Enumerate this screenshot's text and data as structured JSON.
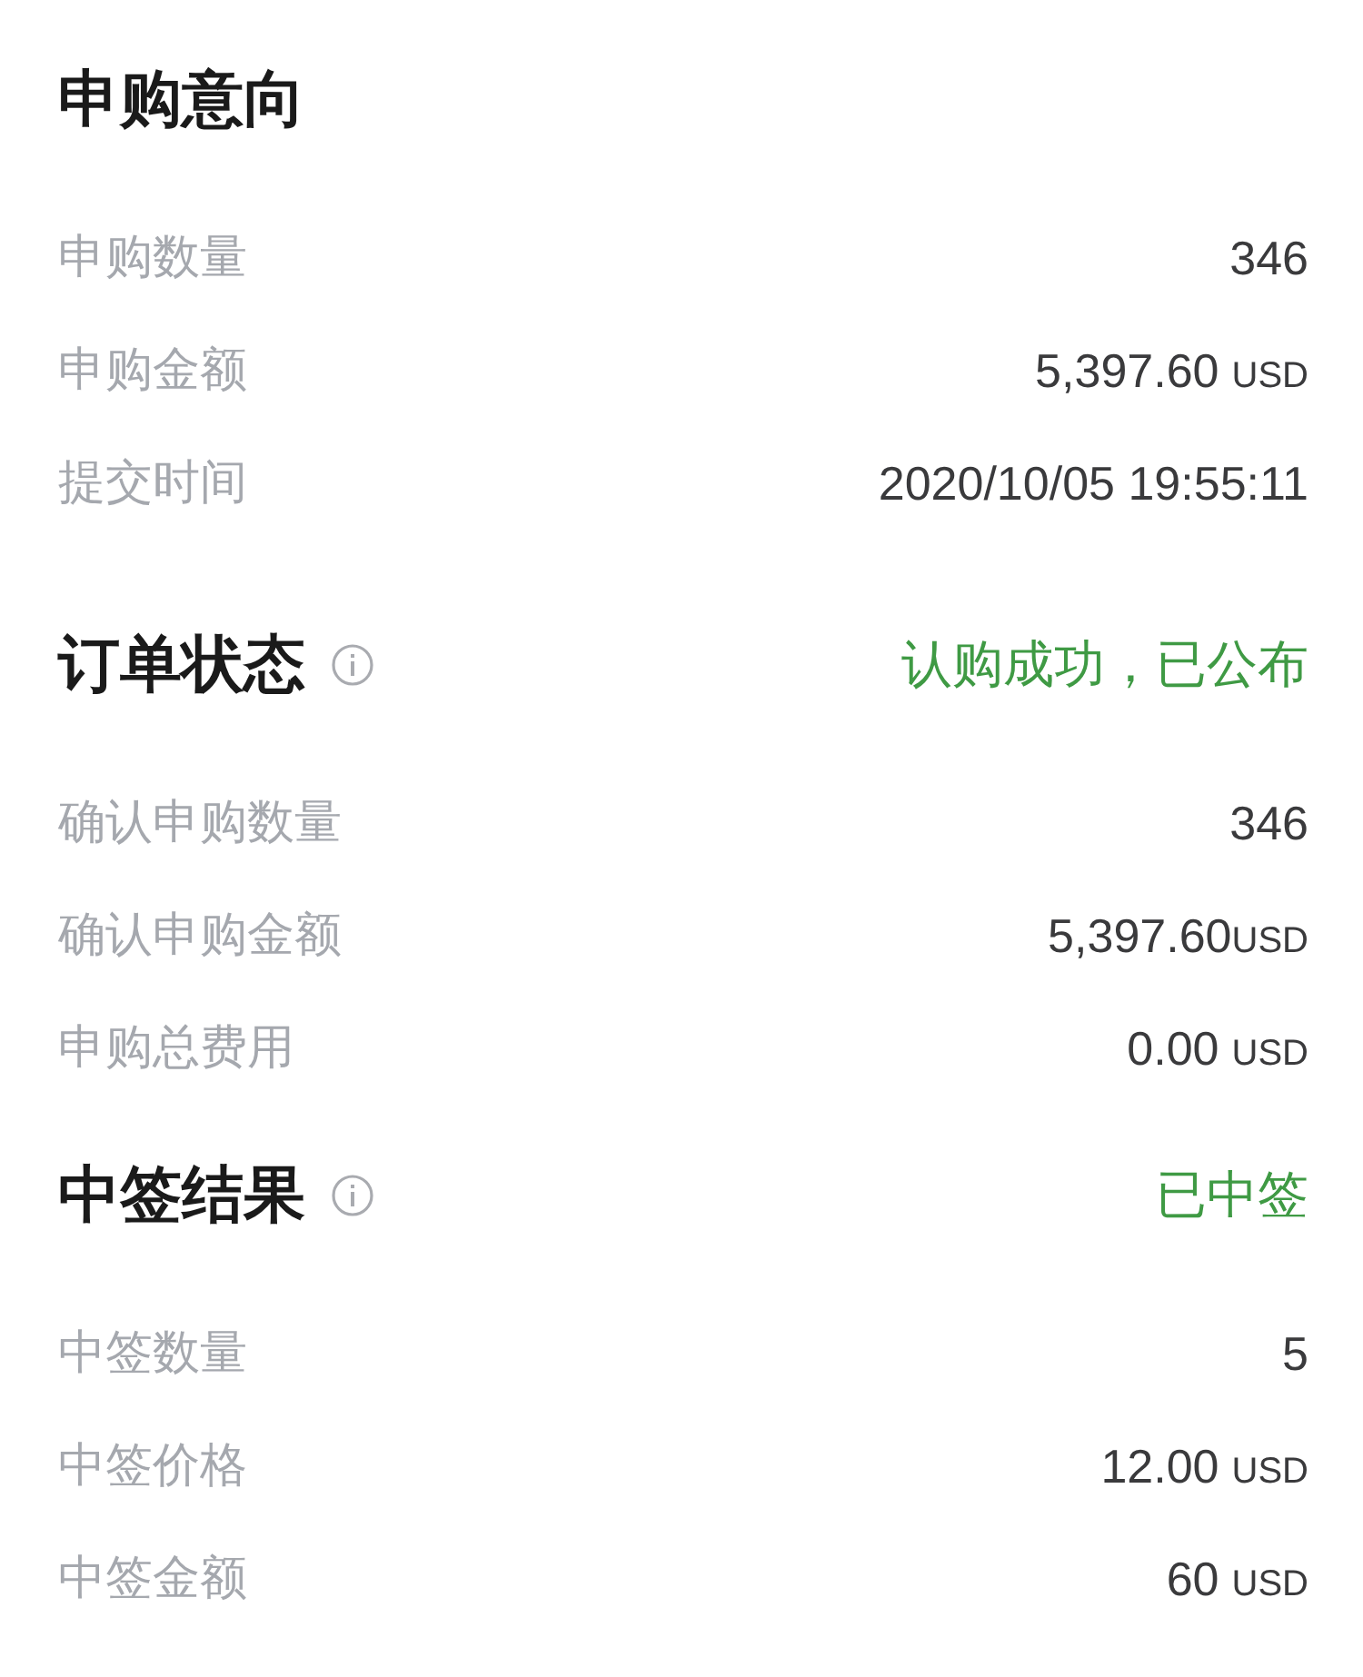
{
  "sections": [
    {
      "title": "申购意向",
      "info_icon": false,
      "rows": [
        {
          "label": "申购数量",
          "value": "346"
        },
        {
          "label": "申购金额",
          "value": "5,397.60",
          "unit": "USD",
          "unit_spaced": true
        },
        {
          "label": "提交时间",
          "value": "2020/10/05 19:55:11"
        }
      ]
    },
    {
      "title": "订单状态",
      "info_icon": true,
      "status": "认购成功，已公布",
      "rows": [
        {
          "label": "确认申购数量",
          "value": "346"
        },
        {
          "label": "确认申购金额",
          "value": "5,397.60",
          "unit": "USD",
          "unit_spaced": false
        },
        {
          "label": "申购总费用",
          "value": "0.00",
          "unit": "USD",
          "unit_spaced": true
        }
      ]
    },
    {
      "title": "中签结果",
      "info_icon": true,
      "status": "已中签",
      "rows": [
        {
          "label": "中签数量",
          "value": "5"
        },
        {
          "label": "中签价格",
          "value": "12.00",
          "unit": "USD",
          "unit_spaced": true
        },
        {
          "label": "中签金额",
          "value": "60",
          "unit": "USD",
          "unit_spaced": true
        }
      ]
    }
  ]
}
